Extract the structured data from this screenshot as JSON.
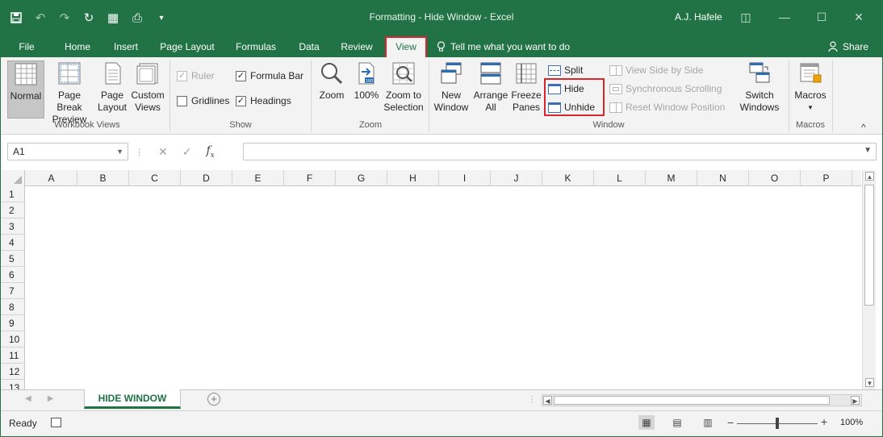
{
  "titlebar": {
    "title": "Formatting - Hide Window  -  Excel",
    "user": "A.J. Hafele",
    "accent": "#217346"
  },
  "tabs": [
    {
      "label": "File",
      "active": false
    },
    {
      "label": "Home",
      "active": false
    },
    {
      "label": "Insert",
      "active": false
    },
    {
      "label": "Page Layout",
      "active": false
    },
    {
      "label": "Formulas",
      "active": false
    },
    {
      "label": "Data",
      "active": false
    },
    {
      "label": "Review",
      "active": false
    },
    {
      "label": "View",
      "active": true
    }
  ],
  "tellme": "Tell me what you want to do",
  "share": "Share",
  "ribbon": {
    "workbook_views": {
      "label": "Workbook Views",
      "normal": "Normal",
      "page_break_1": "Page Break",
      "page_break_2": "Preview",
      "page_layout_1": "Page",
      "page_layout_2": "Layout",
      "custom_1": "Custom",
      "custom_2": "Views"
    },
    "show": {
      "label": "Show",
      "ruler": "Ruler",
      "formula_bar": "Formula Bar",
      "gridlines": "Gridlines",
      "headings": "Headings"
    },
    "zoom": {
      "label": "Zoom",
      "zoom": "Zoom",
      "hundred": "100%",
      "zoom_sel_1": "Zoom to",
      "zoom_sel_2": "Selection"
    },
    "window": {
      "label": "Window",
      "new_1": "New",
      "new_2": "Window",
      "arrange_1": "Arrange",
      "arrange_2": "All",
      "freeze_1": "Freeze",
      "freeze_2": "Panes",
      "split": "Split",
      "hide": "Hide",
      "unhide": "Unhide",
      "side_by_side": "View Side by Side",
      "sync_scroll": "Synchronous Scrolling",
      "reset_pos": "Reset Window Position",
      "switch_1": "Switch",
      "switch_2": "Windows"
    },
    "macros": {
      "label": "Macros",
      "macros": "Macros"
    }
  },
  "formula": {
    "name_box": "A1",
    "content": ""
  },
  "columns": [
    "A",
    "B",
    "C",
    "D",
    "E",
    "F",
    "G",
    "H",
    "I",
    "J",
    "K",
    "L",
    "M",
    "N",
    "O",
    "P"
  ],
  "rows": [
    "1",
    "2",
    "3",
    "4",
    "5",
    "6",
    "7",
    "8",
    "9",
    "10",
    "11",
    "12",
    "13"
  ],
  "sheet_tab": "HIDE WINDOW",
  "status": {
    "ready": "Ready",
    "zoom": "100%",
    "zoom_fraction": 0.5
  }
}
